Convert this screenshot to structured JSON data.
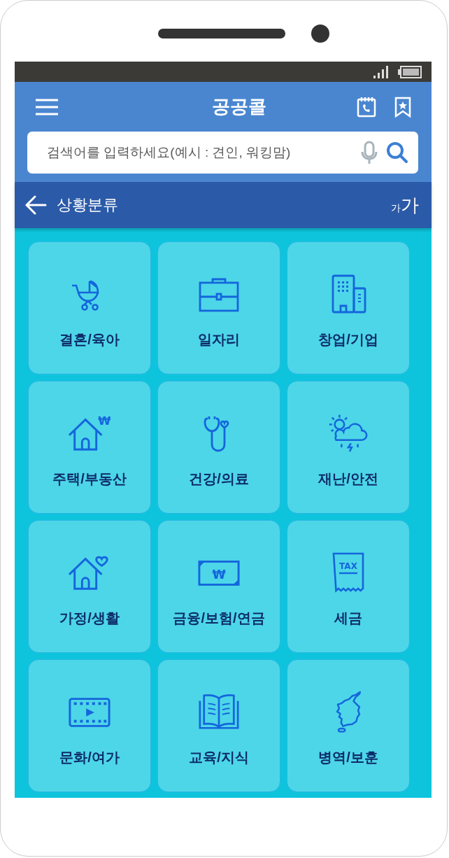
{
  "app_bar": {
    "title": "공공콜"
  },
  "search": {
    "placeholder": "검색어를 입력하세요(예시 : 견인, 워킹맘)"
  },
  "sub_bar": {
    "title": "상황분류",
    "font_small": "가",
    "font_large": "가"
  },
  "categories": [
    {
      "label": "결혼/육아",
      "kind": "stroller"
    },
    {
      "label": "일자리",
      "kind": "briefcase"
    },
    {
      "label": "창업/기업",
      "kind": "buildings"
    },
    {
      "label": "주택/부동산",
      "kind": "house-won",
      "icon_text": "₩"
    },
    {
      "label": "건강/의료",
      "kind": "stethoscope"
    },
    {
      "label": "재난/안전",
      "kind": "storm"
    },
    {
      "label": "가정/생활",
      "kind": "house-heart"
    },
    {
      "label": "금융/보험/연금",
      "kind": "banknote",
      "icon_text": "₩"
    },
    {
      "label": "세금",
      "kind": "tax",
      "icon_text": "TAX"
    },
    {
      "label": "문화/여가",
      "kind": "film"
    },
    {
      "label": "교육/지식",
      "kind": "book"
    },
    {
      "label": "병역/보훈",
      "kind": "map"
    }
  ]
}
